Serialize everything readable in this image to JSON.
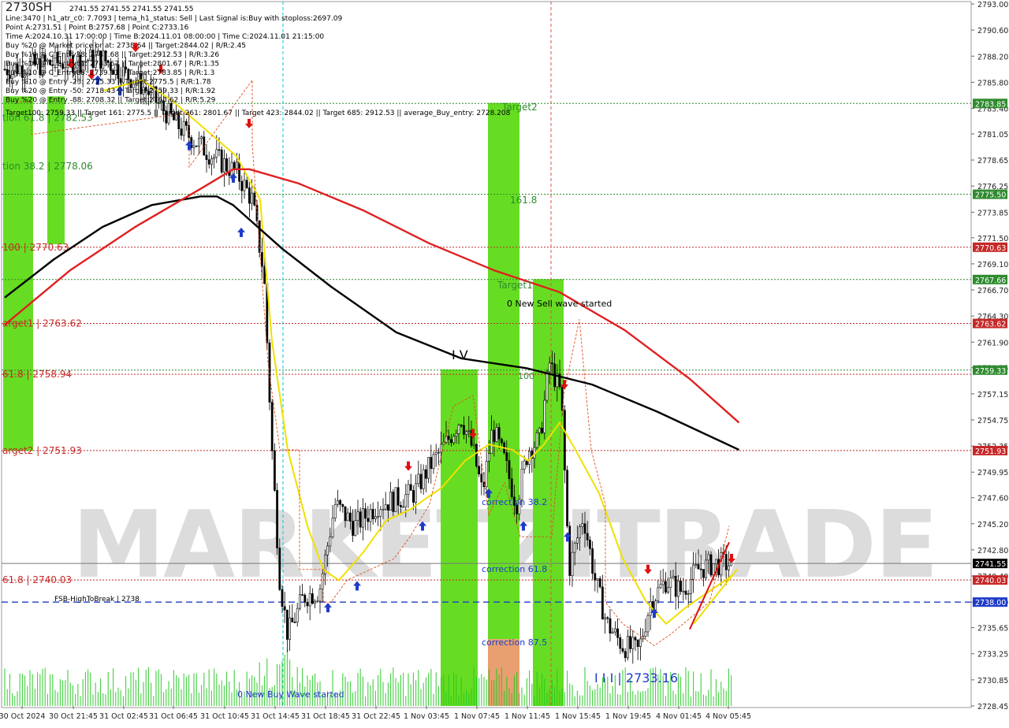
{
  "chart_data": {
    "type": "line",
    "watermark": "MARKETZITRADE",
    "symbol": "2730SH",
    "ylim": [
      2728.45,
      2793.0
    ],
    "y_ticks": [
      "2793.00",
      "2790.60",
      "2788.20",
      "2785.80",
      "2783.40",
      "2781.05",
      "2778.65",
      "2776.25",
      "2773.85",
      "2771.50",
      "2769.10",
      "2766.70",
      "2764.30",
      "2761.90",
      "2759.55",
      "2757.15",
      "2754.75",
      "2752.35",
      "2749.95",
      "2747.60",
      "2745.20",
      "2742.80",
      "2740.40",
      "2738.00",
      "2735.65",
      "2733.25",
      "2730.85",
      "2728.45"
    ],
    "x_ticks": [
      "30 Oct 2024",
      "30 Oct 21:45",
      "31 Oct 02:45",
      "31 Oct 06:45",
      "31 Oct 10:45",
      "31 Oct 14:45",
      "31 Oct 18:45",
      "31 Oct 22:45",
      "1 Nov 03:45",
      "1 Nov 07:45",
      "1 Nov 11:45",
      "1 Nov 15:45",
      "1 Nov 19:45",
      "4 Nov 01:45",
      "4 Nov 05:45"
    ],
    "info_lines": [
      "Line:3470 | h1_atr_c0: 7.7093 | tema_h1_status: Sell | Last Signal is:Buy with stoploss:2697.09",
      "Point A:2731.51 | Point B:2757.68 | Point C:2733.16",
      "Time A:2024.10.31 17:00:00 | Time B:2024.11.01 08:00:00 | Time C:2024.11.01 21:15:00",
      "Buy %20 @ Market price or at: 2738.64 || Target:2844.02 | R/R:2.45",
      "Buy %10 @ C_Entry38: 2747.68 || Target:2912.53 | R/R:3.26",
      "Buy %10 @ C_Entry61: 2743.67 || Target:2801.67 | R/R:1.35",
      "Buy %10 @ C_Entry88: 2739.61 || Target:2783.85 | R/R:1.3",
      "Buy %10 @ Entry -23: 2725.33 || Target:2775.5 | R/R:1.78",
      "Buy %20 @ Entry -50: 2718.43 || Target:2759.33 | R/R:1.92",
      "Buy %20 @ Entry -88: 2708.32 || Target:2763.62 | R/R:5.29",
      "Target100: 2759.33 || Target 161: 2775.5 || Target 261: 2801.67 || Target 423: 2844.02 || Target 685: 2912.53 || average_Buy_entry: 2728.208"
    ],
    "header_price_line": "2741.55 2741.55 2741.55 2741.55",
    "price_badges": [
      {
        "label": "2783.85",
        "value": 2783.85,
        "color": "#2e8b2e",
        "style": "green"
      },
      {
        "label": "2775.50",
        "value": 2775.5,
        "color": "#2e8b2e",
        "style": "green"
      },
      {
        "label": "2770.63",
        "value": 2770.63,
        "color": "#c62828",
        "style": "red"
      },
      {
        "label": "2767.66",
        "value": 2767.66,
        "color": "#2e8b2e",
        "style": "green"
      },
      {
        "label": "2763.62",
        "value": 2763.62,
        "color": "#c62828",
        "style": "red"
      },
      {
        "label": "2759.33",
        "value": 2759.33,
        "color": "#2e8b2e",
        "style": "green"
      },
      {
        "label": "2751.93",
        "value": 2751.93,
        "color": "#c62828",
        "style": "red"
      },
      {
        "label": "2741.55",
        "value": 2741.55,
        "color": "#000000",
        "style": "black"
      },
      {
        "label": "2740.03",
        "value": 2740.03,
        "color": "#c62828",
        "style": "red"
      },
      {
        "label": "2738.00",
        "value": 2738.0,
        "color": "#1e3cc8",
        "style": "blue"
      }
    ],
    "level_labels": [
      {
        "text": "tion 61.8 | 2782.53",
        "value": 2782.53,
        "color": "#2e8b2e"
      },
      {
        "text": "tion 38.2 | 2778.06",
        "value": 2778.06,
        "color": "#2e8b2e"
      },
      {
        "text": "100 | 2770.63",
        "value": 2770.63,
        "color": "#c62828"
      },
      {
        "text": "arget1 | 2763.62",
        "value": 2763.62,
        "color": "#c62828"
      },
      {
        "text": "61.8 | 2758.94",
        "value": 2758.94,
        "color": "#c62828"
      },
      {
        "text": "arget2 | 2751.93",
        "value": 2751.93,
        "color": "#c62828"
      },
      {
        "text": "61.8 | 2740.03",
        "value": 2740.03,
        "color": "#c62828"
      }
    ],
    "annotations": [
      {
        "text": "Target2",
        "color": "#2e8b2e"
      },
      {
        "text": "161.8",
        "color": "#2e8b2e"
      },
      {
        "text": "Target1",
        "color": "#2e8b2e"
      },
      {
        "text": "0 New Sell wave started",
        "color": "#000000"
      },
      {
        "text": "I V",
        "color": "#000000"
      },
      {
        "text": "100",
        "color": "#2e8b2e"
      },
      {
        "text": "correction 38.2",
        "color": "#1e3cc8"
      },
      {
        "text": "correction 61.8",
        "color": "#1e3cc8"
      },
      {
        "text": "correction 87.5",
        "color": "#1e3cc8"
      },
      {
        "text": "I I I | 2733.16",
        "color": "#1e3cc8"
      },
      {
        "text": "0 New Buy Wave started",
        "color": "#1e3cc8"
      },
      {
        "text": "FSB-HighToBreak | 2738",
        "color": "#000000"
      }
    ],
    "series": [
      {
        "name": "",
        "color": "#000000",
        "points": [
          [
            0,
            2766.0
          ],
          [
            3,
            2769.5
          ],
          [
            6,
            2772.5
          ],
          [
            9,
            2774.5
          ],
          [
            12,
            2775.3
          ],
          [
            13,
            2775.3
          ],
          [
            14,
            2774.5
          ],
          [
            17,
            2770.5
          ],
          [
            20,
            2767.0
          ],
          [
            24,
            2762.8
          ],
          [
            28,
            2760.4
          ],
          [
            32,
            2759.5
          ],
          [
            36,
            2758.0
          ],
          [
            40,
            2755.5
          ],
          [
            44,
            2752.7
          ],
          [
            45,
            2752.0
          ]
        ]
      },
      {
        "name": "",
        "color": "#e02020",
        "points": [
          [
            0,
            2763.5
          ],
          [
            4,
            2768.5
          ],
          [
            8,
            2772.5
          ],
          [
            12,
            2776.0
          ],
          [
            14,
            2777.8
          ],
          [
            15,
            2777.8
          ],
          [
            18,
            2776.5
          ],
          [
            22,
            2774.0
          ],
          [
            26,
            2771.0
          ],
          [
            30,
            2768.5
          ],
          [
            34,
            2766.5
          ],
          [
            38,
            2763.0
          ],
          [
            42,
            2758.5
          ],
          [
            45,
            2754.5
          ]
        ]
      }
    ]
  }
}
